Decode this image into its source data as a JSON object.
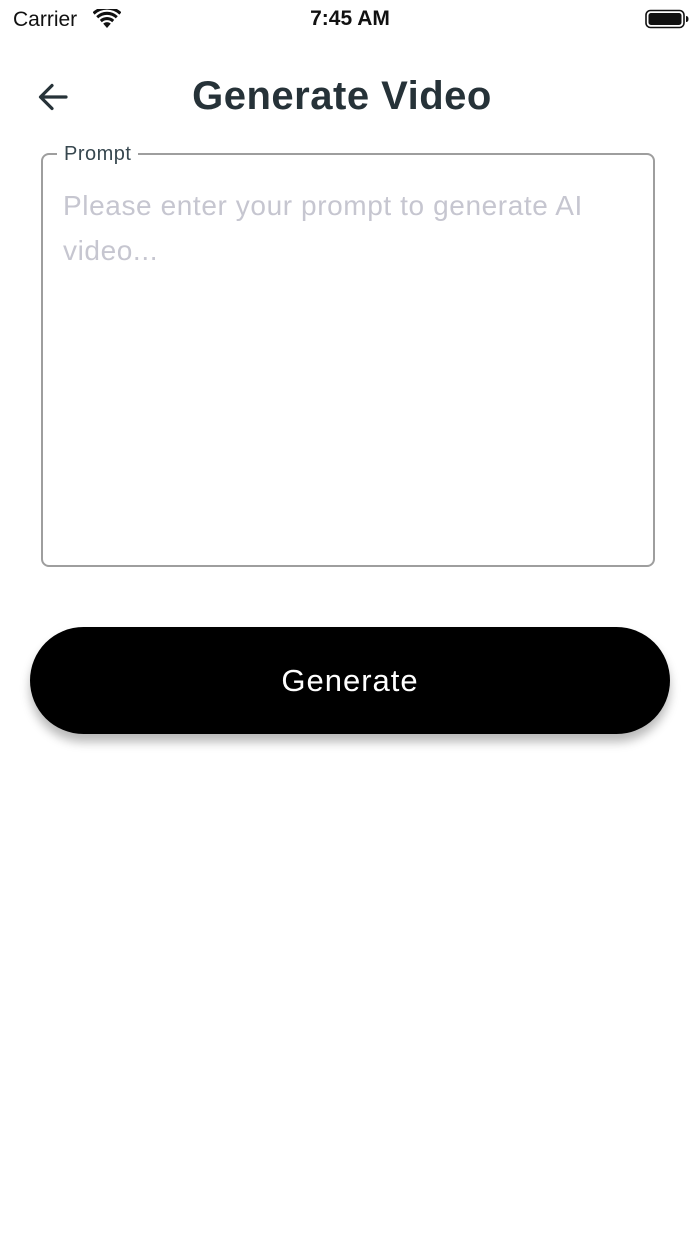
{
  "status_bar": {
    "carrier": "Carrier",
    "time": "7:45 AM",
    "wifi_icon": "wifi-icon",
    "battery_icon": "battery-full-icon"
  },
  "header": {
    "title": "Generate Video",
    "back_icon": "arrow-left-icon"
  },
  "prompt": {
    "label": "Prompt",
    "value": "",
    "placeholder": "Please enter your prompt to generate AI video..."
  },
  "actions": {
    "generate_label": "Generate"
  },
  "colors": {
    "title": "#263238",
    "button_background": "#000000",
    "button_text": "#ffffff",
    "placeholder": "#c6c6d0",
    "field_border": "#9e9e9e"
  }
}
